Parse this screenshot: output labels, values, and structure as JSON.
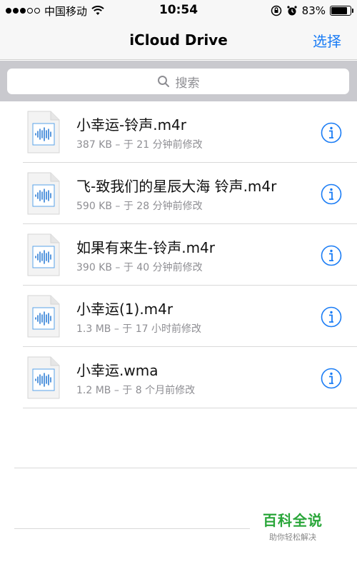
{
  "status": {
    "carrier": "中国移动",
    "time": "10:54",
    "battery_percent": "83%",
    "battery_level": 0.83,
    "signal_bars_filled": 3
  },
  "nav": {
    "title": "iCloud Drive",
    "select_label": "选择",
    "accent_color": "#1a7cf5"
  },
  "search": {
    "placeholder": "搜索"
  },
  "files": [
    {
      "name": "小幸运-铃声.m4r",
      "meta": "387 KB – 于 21 分钟前修改"
    },
    {
      "name": "飞-致我们的星辰大海 铃声.m4r",
      "meta": "590 KB – 于 28 分钟前修改"
    },
    {
      "name": "如果有来生-铃声.m4r",
      "meta": "390 KB – 于 40 分钟前修改"
    },
    {
      "name": "小幸运(1).m4r",
      "meta": "1.3 MB – 于 17 小时前修改"
    },
    {
      "name": "小幸运.wma",
      "meta": "1.2 MB – 于 8 个月前修改"
    }
  ],
  "watermark": {
    "title": "百科全说",
    "subtitle": "助你轻松解决"
  }
}
